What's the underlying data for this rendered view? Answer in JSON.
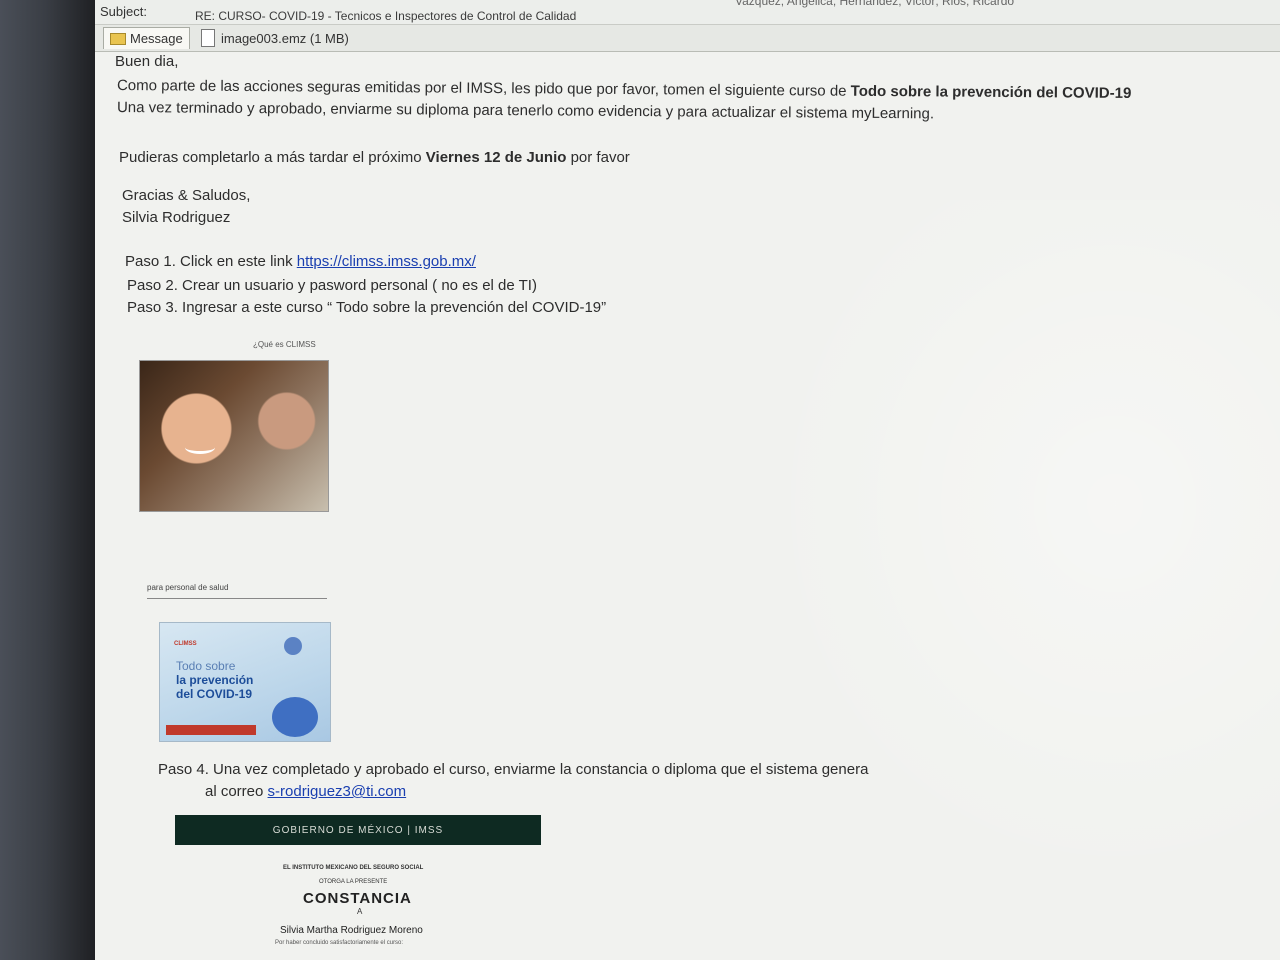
{
  "header": {
    "subject_label": "Subject:",
    "subject_value": "RE: CURSO- COVID-19 - Tecnicos e Inspectores de Control de Calidad",
    "recipients_partial": "Vazquez, Angelica; Hernandez, Victor; Rios, Ricardo"
  },
  "tabs": {
    "message_label": "Message",
    "attachment_label": "image003.emz (1 MB)"
  },
  "email": {
    "greeting": "Buen dia,",
    "line1_pre": "Como parte de las acciones seguras emitidas por el IMSS, les pido que por favor, tomen el siguiente curso de ",
    "line1_bold": "Todo sobre la prevención del COVID-19",
    "line2": "Una vez terminado y aprobado, enviarme su diploma para tenerlo como evidencia y para actualizar el sistema myLearning.",
    "deadline_pre": "Pudieras completarlo a más tardar el próximo ",
    "deadline_bold": "Viernes 12 de Junio",
    "deadline_post": " por favor",
    "closing": "Gracias & Saludos,",
    "signature": "Silvia Rodriguez",
    "step1_pre": "Paso 1. Click en este link ",
    "step1_link": "https://climss.imss.gob.mx/",
    "step2": "Paso 2. Crear un usuario y pasword personal  ( no es el de TI)",
    "step3": "Paso 3. Ingresar a este curso “ Todo sobre la prevención del COVID-19”",
    "photo_caption": "¿Qué es CLIMSS",
    "salud_label": "para personal de salud",
    "step4": "Paso 4. Una vez completado y aprobado el curso, enviarme la constancia o diploma que el sistema genera",
    "step4b_pre": "al correo ",
    "step4b_link": "s-rodriguez3@ti.com"
  },
  "covid_banner": {
    "brand": "CLIMSS",
    "line1": "Todo sobre",
    "line2": "la prevención",
    "line3": "del COVID-19"
  },
  "certificate": {
    "gob_banner": "GOBIERNO DE MÉXICO  |  IMSS",
    "institute": "EL INSTITUTO MEXICANO DEL SEGURO SOCIAL",
    "otorga": "OTORGA LA PRESENTE",
    "title": "CONSTANCIA",
    "a": "A",
    "name": "Silvia Martha Rodriguez Moreno",
    "small": "Por haber concluido satisfactoriamente el curso:"
  }
}
